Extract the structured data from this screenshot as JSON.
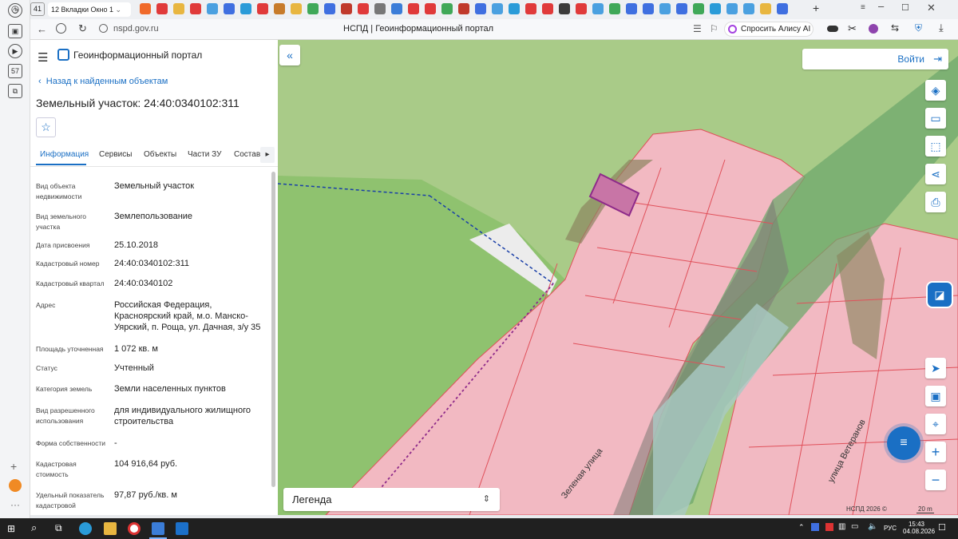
{
  "browser": {
    "tab_count": "41",
    "tab_group_count": "12",
    "tab_group_label": "Вкладки Окно 1",
    "url": "nspd.gov.ru",
    "page_title": "НСПД | Геоинформационный портал",
    "alice_button": "Спросить Алису AI",
    "left_badge": "57"
  },
  "portal": {
    "title": "Геоинформационный портал",
    "back_link": "Назад к найденным объектам",
    "object_title": "Земельный участок: 24:40:0340102:311",
    "tabs": [
      "Информация",
      "Сервисы",
      "Объекты",
      "Части ЗУ",
      "Состав"
    ],
    "rows": [
      {
        "label": "Вид объекта недвижимости",
        "value": "Земельный участок"
      },
      {
        "label": "Вид земельного участка",
        "value": "Землепользование"
      },
      {
        "label": "Дата присвоения",
        "value": "25.10.2018"
      },
      {
        "label": "Кадастровый номер",
        "value": "24:40:0340102:311"
      },
      {
        "label": "Кадастровый квартал",
        "value": "24:40:0340102"
      },
      {
        "label": "Адрес",
        "value": "Российская Федерация, Красноярский край, м.о. Манско-Уярский, п. Роща, ул. Дачная, з/у 35"
      },
      {
        "label": "Площадь уточненная",
        "value": "1 072 кв. м"
      },
      {
        "label": "Статус",
        "value": "Учтенный"
      },
      {
        "label": "Категория земель",
        "value": "Земли населенных пунктов"
      },
      {
        "label": "Вид разрешенного использования",
        "value": "для индивидуального жилищного строительства"
      },
      {
        "label": "Форма собственности",
        "value": "-"
      },
      {
        "label": "Кадастровая стоимость",
        "value": "104 916,64 руб."
      },
      {
        "label": "Удельный показатель кадастровой",
        "value": "97,87 руб./кв. м"
      }
    ]
  },
  "map": {
    "login_button": "Войти",
    "legend_label": "Легенда",
    "street_1": "Зеленая улица",
    "street_2": "улица Ветеранов",
    "attribution": "НСПД 2026 ©",
    "scale": "20 m"
  },
  "taskbar": {
    "lang": "РУС",
    "time": "15:43",
    "date": "04.08.2026"
  },
  "colors": {
    "accent": "#1a6fc4",
    "parcel_fill": "#f3b7c0",
    "parcel_stroke": "#e0505a",
    "forest": "#8dbf6a",
    "selected": "#8e2a8a"
  }
}
